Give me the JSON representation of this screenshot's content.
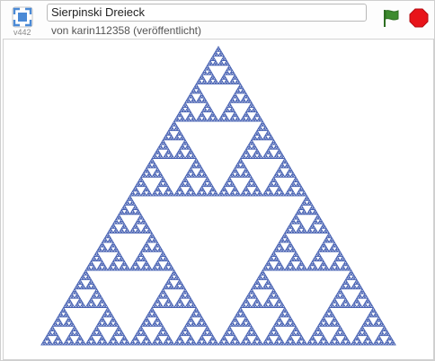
{
  "header": {
    "version_label": "v442",
    "project_title": "Sierpinski Dreieck",
    "byline": "von karin112358 (veröffentlicht)"
  },
  "controls": {
    "fullscreen_icon": "fullscreen-icon",
    "green_flag_icon": "green-flag-icon",
    "stop_icon": "stop-sign-icon"
  },
  "stage": {
    "drawing": "sierpinski-triangle",
    "recursion_depth": 7,
    "line_color": "#4a64b4",
    "background": "#ffffff"
  },
  "colors": {
    "accent_blue": "#4b8ad6",
    "flag_green": "#3d8b2f",
    "stop_red": "#e8141a"
  }
}
